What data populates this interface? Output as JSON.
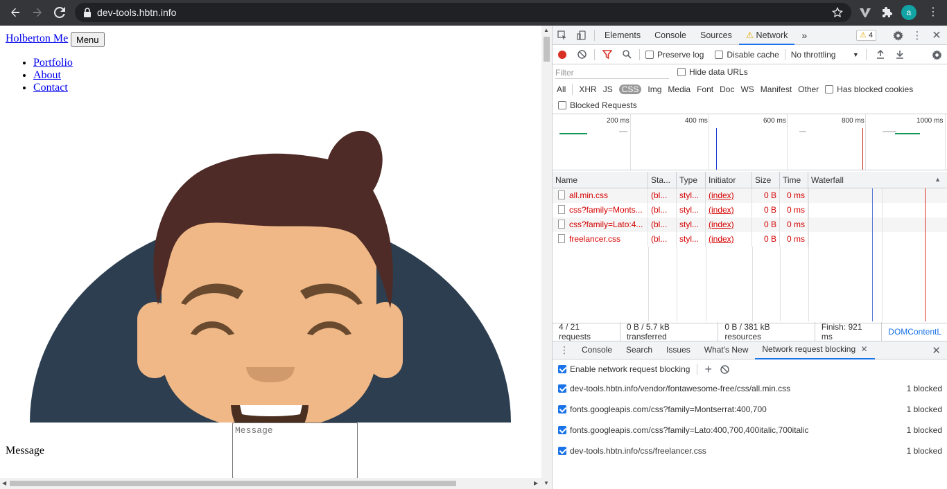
{
  "browser": {
    "url": "dev-tools.hbtn.info",
    "avatar_letter": "a"
  },
  "page": {
    "site_title": "Holberton Me",
    "menu_button": "Menu",
    "nav": [
      "Portfolio",
      "About",
      "Contact"
    ],
    "message_label": "Message",
    "message_placeholder": "Message",
    "illustration_colors": {
      "background_circle": "#2c3e50",
      "hair": "#4e2b26",
      "skin": "#f0b887",
      "mouth": "#4a2e1f"
    }
  },
  "devtools": {
    "tabs": [
      "Elements",
      "Console",
      "Sources",
      "Network"
    ],
    "active_tab": "Network",
    "more_tabs": "»",
    "warnings": "4",
    "toolbar": {
      "preserve_log": "Preserve log",
      "disable_cache": "Disable cache",
      "throttling": "No throttling"
    },
    "filter": {
      "placeholder": "Filter",
      "hide_data_urls": "Hide data URLs"
    },
    "types": [
      "All",
      "XHR",
      "JS",
      "CSS",
      "Img",
      "Media",
      "Font",
      "Doc",
      "WS",
      "Manifest",
      "Other"
    ],
    "active_type": "CSS",
    "has_blocked_cookies": "Has blocked cookies",
    "blocked_requests": "Blocked Requests",
    "timeline_labels": [
      "200 ms",
      "400 ms",
      "600 ms",
      "800 ms",
      "1000 ms"
    ],
    "columns": [
      "Name",
      "Sta...",
      "Type",
      "Initiator",
      "Size",
      "Time",
      "Waterfall"
    ],
    "rows": [
      {
        "name": "all.min.css",
        "status": "(bl...",
        "type": "styl...",
        "initiator": "(index)",
        "size": "0 B",
        "time": "0 ms"
      },
      {
        "name": "css?family=Monts...",
        "status": "(bl...",
        "type": "styl...",
        "initiator": "(index)",
        "size": "0 B",
        "time": "0 ms"
      },
      {
        "name": "css?family=Lato:4...",
        "status": "(bl...",
        "type": "styl...",
        "initiator": "(index)",
        "size": "0 B",
        "time": "0 ms"
      },
      {
        "name": "freelancer.css",
        "status": "(bl...",
        "type": "styl...",
        "initiator": "(index)",
        "size": "0 B",
        "time": "0 ms"
      }
    ],
    "summary": {
      "requests": "4 / 21 requests",
      "transferred": "0 B / 5.7 kB transferred",
      "resources": "0 B / 381 kB resources",
      "finish": "Finish: 921 ms",
      "dcl": "DOMContentL"
    },
    "drawer": {
      "tabs": [
        "Console",
        "Search",
        "Issues",
        "What's New",
        "Network request blocking"
      ],
      "active_tab": "Network request blocking",
      "enable_label": "Enable network request blocking",
      "rules": [
        {
          "pattern": "dev-tools.hbtn.info/vendor/fontawesome-free/css/all.min.css",
          "count": "1 blocked"
        },
        {
          "pattern": "fonts.googleapis.com/css?family=Montserrat:400,700",
          "count": "1 blocked"
        },
        {
          "pattern": "fonts.googleapis.com/css?family=Lato:400,700,400italic,700italic",
          "count": "1 blocked"
        },
        {
          "pattern": "dev-tools.hbtn.info/css/freelancer.css",
          "count": "1 blocked"
        }
      ]
    }
  }
}
